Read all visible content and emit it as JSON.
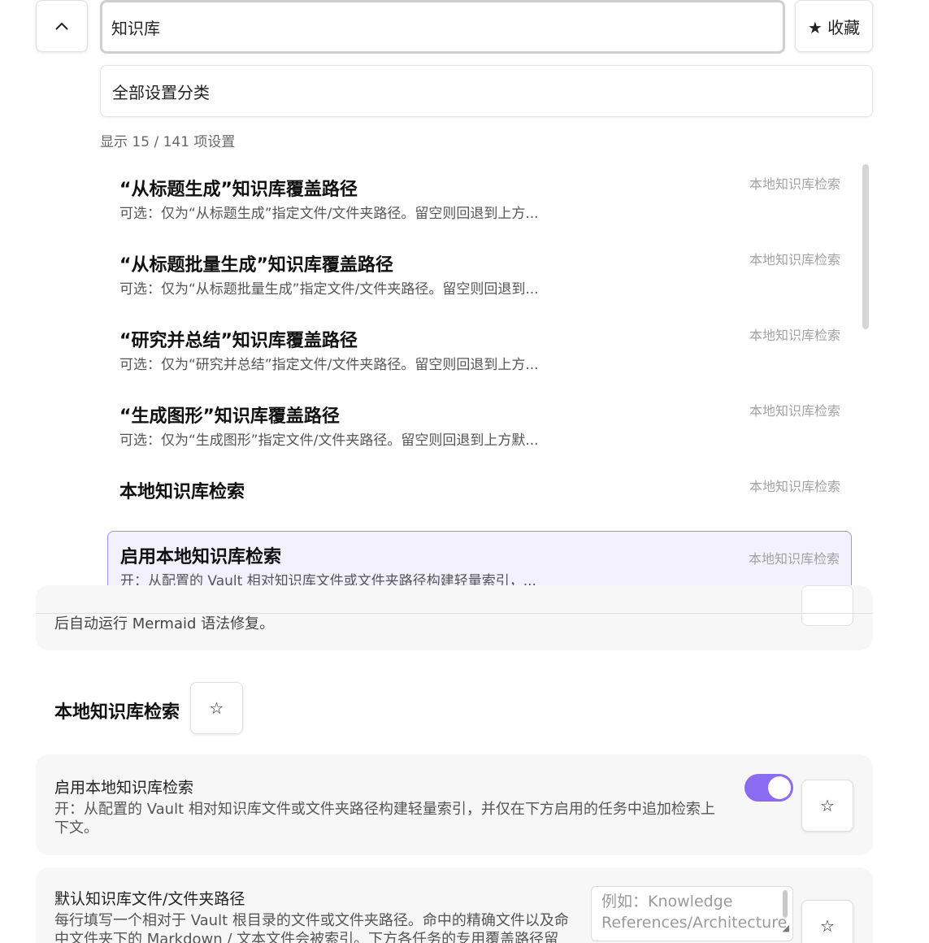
{
  "search": {
    "value": "知识库",
    "favorites_label": "★ 收藏",
    "collapse_icon": "chevron-up-icon"
  },
  "category_select": {
    "value": "全部设置分类"
  },
  "result_count": "显示 15 / 141 项设置",
  "results": [
    {
      "title": "“从标题生成”知识库覆盖路径",
      "desc": "可选：仅为“从标题生成”指定文件/文件夹路径。留空则回退到上方...",
      "category": "本地知识库检索"
    },
    {
      "title": "“从标题批量生成”知识库覆盖路径",
      "desc": "可选：仅为“从标题批量生成”指定文件/文件夹路径。留空则回退到...",
      "category": "本地知识库检索"
    },
    {
      "title": "“研究并总结”知识库覆盖路径",
      "desc": "可选：仅为“研究并总结”指定文件/文件夹路径。留空则回退到上方...",
      "category": "本地知识库检索"
    },
    {
      "title": "“生成图形”知识库覆盖路径",
      "desc": "可选：仅为“生成图形”指定文件/文件夹路径。留空则回退到上方默...",
      "category": "本地知识库检索"
    },
    {
      "title": "本地知识库检索",
      "desc": "",
      "category": "本地知识库检索"
    },
    {
      "title": "启用本地知识库检索",
      "desc": "开：从配置的 Vault 相对知识库文件或文件夹路径构建轻量索引，...",
      "category": "本地知识库检索"
    }
  ],
  "prev_card_text": "后自动运行 Mermaid 语法修复。",
  "section": {
    "title": "本地知识库检索",
    "star": "☆"
  },
  "settings": [
    {
      "label": "启用本地知识库检索",
      "desc": "开：从配置的 Vault 相对知识库文件或文件夹路径构建轻量索引，并仅在下方启用的任务中追加检索上下文。",
      "toggle_on": true,
      "star": "☆"
    },
    {
      "label": "默认知识库文件/文件夹路径",
      "desc": "每行填写一个相对于 Vault 根目录的文件或文件夹路径。命中的精确文件以及命中文件夹下的 Markdown / 文本文件会被索引。下方各任务的专用覆盖路径留",
      "placeholder": "例如：Knowledge References/Architecture",
      "star": "☆"
    }
  ],
  "colors": {
    "accent": "#8b6cf0",
    "selected_bg": "#f4f1ff",
    "selected_border": "#a78bfa"
  }
}
